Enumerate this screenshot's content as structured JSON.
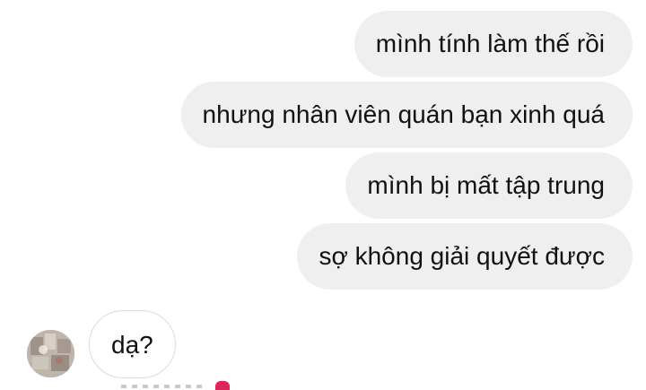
{
  "messages": {
    "outgoing": [
      {
        "text": "mình tính làm thế rồi"
      },
      {
        "text": "nhưng nhân viên quán bạn xinh quá"
      },
      {
        "text": "mình bị mất tập trung"
      },
      {
        "text": "sợ không giải quyết được"
      }
    ],
    "incoming": [
      {
        "text": "dạ?"
      }
    ]
  },
  "colors": {
    "outgoing_bubble_bg": "#efefef",
    "incoming_bubble_border": "#dbdbdb",
    "text": "#111111",
    "background": "#ffffff"
  },
  "icons": {
    "avatar": "user-avatar",
    "reaction": "heart-icon"
  }
}
